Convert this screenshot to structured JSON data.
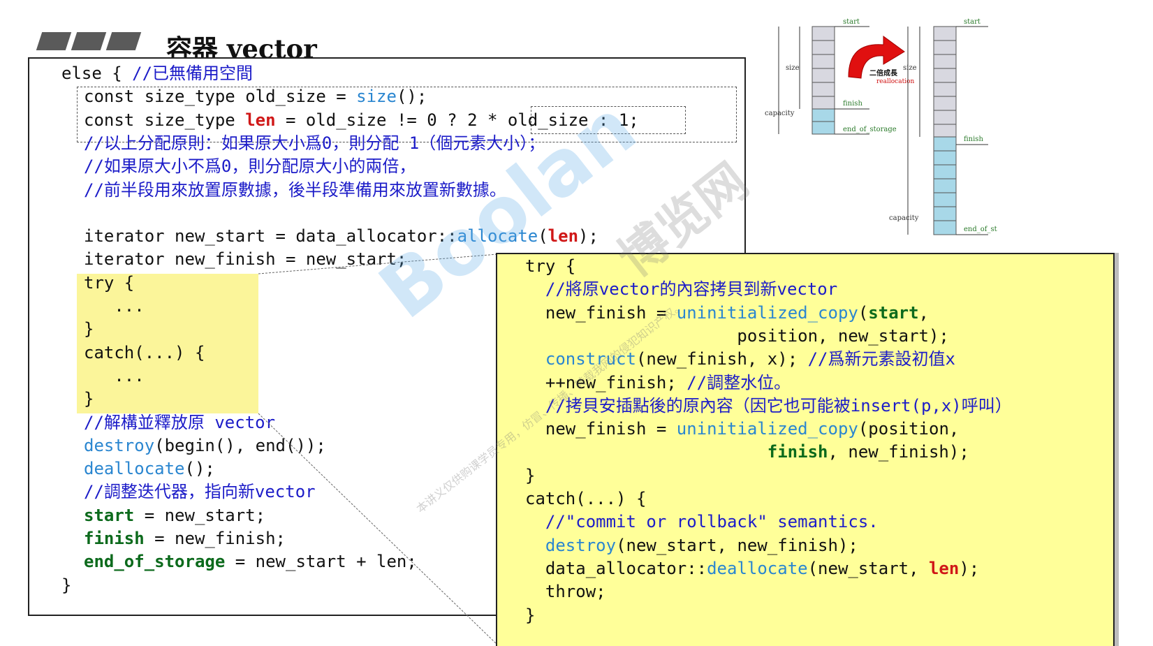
{
  "header": {
    "title": "容器 vector"
  },
  "code_left": [
    {
      "parts": [
        {
          "t": "else { ",
          "c": ""
        },
        {
          "t": "//已無備用空間",
          "c": "cmt"
        }
      ]
    },
    {
      "parts": [
        {
          "t": "const size_type old_size = ",
          "c": ""
        },
        {
          "t": "size",
          "c": "fn"
        },
        {
          "t": "();",
          "c": ""
        }
      ]
    },
    {
      "parts": [
        {
          "t": "const size_type ",
          "c": ""
        },
        {
          "t": "len",
          "c": "red"
        },
        {
          "t": " = old_size != 0 ? 2 * old_size : 1;",
          "c": ""
        }
      ]
    },
    {
      "parts": [
        {
          "t": "//以上分配原則：如果原大小爲0，則分配 1（個元素大小）；",
          "c": "cmt"
        }
      ]
    },
    {
      "parts": [
        {
          "t": "//如果原大小不爲0，則分配原大小的兩倍，",
          "c": "cmt"
        }
      ]
    },
    {
      "parts": [
        {
          "t": "//前半段用來放置原數據，後半段準備用來放置新數據。",
          "c": "cmt"
        }
      ]
    },
    {
      "parts": [
        {
          "t": "",
          "c": ""
        }
      ]
    },
    {
      "parts": [
        {
          "t": "iterator new_start = data_allocator::",
          "c": ""
        },
        {
          "t": "allocate",
          "c": "fn"
        },
        {
          "t": "(",
          "c": ""
        },
        {
          "t": "len",
          "c": "red"
        },
        {
          "t": ");",
          "c": ""
        }
      ]
    },
    {
      "parts": [
        {
          "t": "iterator new_finish = new_start;",
          "c": ""
        }
      ]
    },
    {
      "parts": [
        {
          "t": "try {",
          "c": ""
        }
      ]
    },
    {
      "parts": [
        {
          "t": "   ...",
          "c": ""
        }
      ]
    },
    {
      "parts": [
        {
          "t": "}",
          "c": ""
        }
      ]
    },
    {
      "parts": [
        {
          "t": "catch(...) {",
          "c": ""
        }
      ]
    },
    {
      "parts": [
        {
          "t": "   ...",
          "c": ""
        }
      ]
    },
    {
      "parts": [
        {
          "t": "}",
          "c": ""
        }
      ]
    },
    {
      "parts": [
        {
          "t": "//解構並釋放原 vector",
          "c": "cmt"
        }
      ]
    },
    {
      "parts": [
        {
          "t": "destroy",
          "c": "fn"
        },
        {
          "t": "(begin(), end());",
          "c": ""
        }
      ]
    },
    {
      "parts": [
        {
          "t": "deallocate",
          "c": "fn"
        },
        {
          "t": "();",
          "c": ""
        }
      ]
    },
    {
      "parts": [
        {
          "t": "//調整迭代器，指向新vector",
          "c": "cmt"
        }
      ]
    },
    {
      "parts": [
        {
          "t": "start",
          "c": "grn"
        },
        {
          "t": " = new_start;",
          "c": ""
        }
      ]
    },
    {
      "parts": [
        {
          "t": "finish",
          "c": "grn"
        },
        {
          "t": " = new_finish;",
          "c": ""
        }
      ]
    },
    {
      "parts": [
        {
          "t": "end_of_storage",
          "c": "grn"
        },
        {
          "t": " = new_start + len;",
          "c": ""
        }
      ]
    },
    {
      "parts": [
        {
          "t": "}",
          "c": ""
        }
      ]
    }
  ],
  "code_right": [
    {
      "parts": [
        {
          "t": "try {",
          "c": ""
        }
      ]
    },
    {
      "parts": [
        {
          "t": "  //將原vector的內容拷貝到新vector",
          "c": "cmt"
        }
      ]
    },
    {
      "parts": [
        {
          "t": "  new_finish = ",
          "c": ""
        },
        {
          "t": "uninitialized_copy",
          "c": "fn"
        },
        {
          "t": "(",
          "c": ""
        },
        {
          "t": "start",
          "c": "grn"
        },
        {
          "t": ",",
          "c": ""
        }
      ]
    },
    {
      "parts": [
        {
          "t": "                     position, new_start);",
          "c": ""
        }
      ]
    },
    {
      "parts": [
        {
          "t": "  ",
          "c": ""
        },
        {
          "t": "construct",
          "c": "fn"
        },
        {
          "t": "(new_finish, x); ",
          "c": ""
        },
        {
          "t": "//爲新元素設初值x",
          "c": "cmt"
        }
      ]
    },
    {
      "parts": [
        {
          "t": "  ++new_finish; ",
          "c": ""
        },
        {
          "t": "//調整水位。",
          "c": "cmt"
        }
      ]
    },
    {
      "parts": [
        {
          "t": "  //拷貝安插點後的原內容（因它也可能被insert(p,x)呼叫）",
          "c": "cmt"
        }
      ]
    },
    {
      "parts": [
        {
          "t": "  new_finish = ",
          "c": ""
        },
        {
          "t": "uninitialized_copy",
          "c": "fn"
        },
        {
          "t": "(position,",
          "c": ""
        }
      ]
    },
    {
      "parts": [
        {
          "t": "                        ",
          "c": ""
        },
        {
          "t": "finish",
          "c": "grn"
        },
        {
          "t": ", new_finish);",
          "c": ""
        }
      ]
    },
    {
      "parts": [
        {
          "t": "}",
          "c": ""
        }
      ]
    },
    {
      "parts": [
        {
          "t": "catch(...) {",
          "c": ""
        }
      ]
    },
    {
      "parts": [
        {
          "t": "  //\"commit or rollback\" semantics.",
          "c": "cmt"
        }
      ]
    },
    {
      "parts": [
        {
          "t": "  ",
          "c": ""
        },
        {
          "t": "destroy",
          "c": "fn"
        },
        {
          "t": "(new_start, new_finish);",
          "c": ""
        }
      ]
    },
    {
      "parts": [
        {
          "t": "  data_allocator::",
          "c": ""
        },
        {
          "t": "deallocate",
          "c": "fn"
        },
        {
          "t": "(new_start, ",
          "c": ""
        },
        {
          "t": "len",
          "c": "red"
        },
        {
          "t": ");",
          "c": ""
        }
      ]
    },
    {
      "parts": [
        {
          "t": "  throw;",
          "c": ""
        }
      ]
    },
    {
      "parts": [
        {
          "t": "}",
          "c": ""
        }
      ]
    }
  ],
  "diagram": {
    "label_start": "start",
    "label_size": "size",
    "label_finish": "finish",
    "label_capacity": "capacity",
    "label_end": "end_of_storage",
    "label_end_short": "end_of_st",
    "label_grow": "二倍成長",
    "label_realloc": "reallocation",
    "colors": {
      "used": "#d8d8e0",
      "spare": "#a8d8e8",
      "arrow": "#e01010"
    }
  },
  "watermark": {
    "brand": "Boolan",
    "cn": "博览网",
    "note": "本讲义仅供购课学员专用，仿冒、传播、转载我网的侵犯知识产权。"
  }
}
